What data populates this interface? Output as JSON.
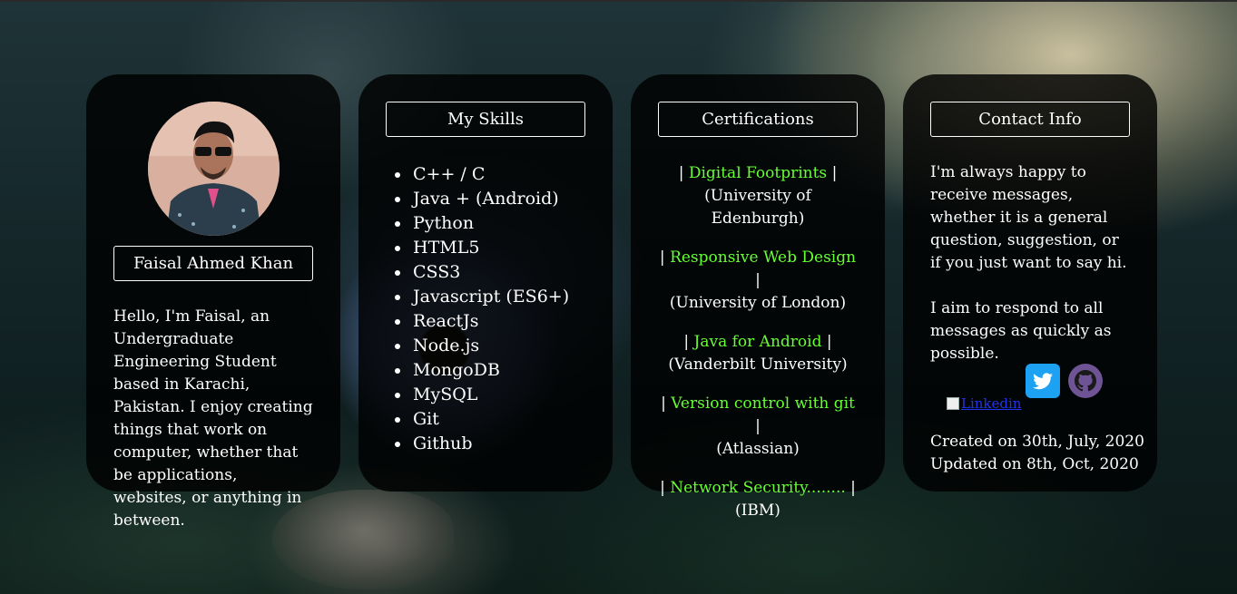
{
  "profile": {
    "name": "Faisal Ahmed Khan",
    "bio": "Hello, I'm Faisal, an Undergraduate Engineering Student based in Karachi, Pakistan. I enjoy creating things that work on computer, whether that be applications, websites, or anything in between."
  },
  "skills": {
    "title": "My Skills",
    "items": [
      "C++ / C",
      "Java + (Android)",
      "Python",
      "HTML5",
      "CSS3",
      "Javascript (ES6+)",
      "ReactJs",
      "Node.js",
      "MongoDB",
      "MySQL",
      "Git",
      "Github"
    ]
  },
  "certifications": {
    "title": "Certifications",
    "items": [
      {
        "name": "Digital Footprints",
        "issuer": "(University of Edenburgh)"
      },
      {
        "name": "Responsive Web Design",
        "issuer": "(University of London)"
      },
      {
        "name": "Java for Android",
        "issuer": "(Vanderbilt University)"
      },
      {
        "name": "Version control with git",
        "issuer": "(Atlassian)"
      },
      {
        "name": "Network Security........",
        "issuer": "(IBM)"
      }
    ],
    "pipe": "|"
  },
  "contact": {
    "title": "Contact Info",
    "paragraph_1": "I'm always happy to receive messages, whether it is a general question, suggestion, or if you just want to say hi.",
    "paragraph_2": "I aim to respond to all messages as quickly as possible.",
    "linkedin_alt": "Linkedin",
    "created": "Created on 30th, July, 2020",
    "updated": "Updated on 8th, Oct, 2020"
  },
  "icons": {
    "twitter": "twitter-icon",
    "github": "github-icon",
    "linkedin": "linkedin-icon"
  },
  "colors": {
    "accent": "#66ff33",
    "twitter": "#1da1f2",
    "github": "#6e5494",
    "link": "#2233ee"
  }
}
